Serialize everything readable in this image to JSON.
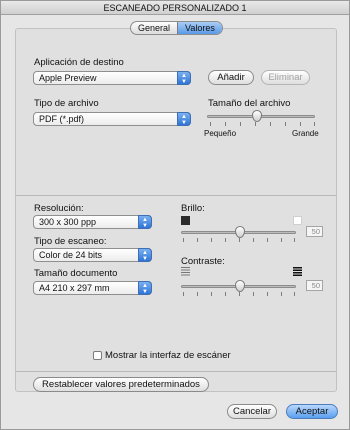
{
  "window": {
    "title": "ESCANEADO PERSONALIZADO 1"
  },
  "tabs": [
    {
      "label": "General",
      "active": false
    },
    {
      "label": "Valores",
      "active": true
    }
  ],
  "destination": {
    "label": "Aplicación de destino",
    "value": "Apple Preview",
    "add_label": "Añadir",
    "remove_label": "Eliminar"
  },
  "file_type": {
    "label": "Tipo de archivo",
    "value": "PDF (*.pdf)"
  },
  "file_size": {
    "label": "Tamaño del archivo",
    "min_label": "Pequeño",
    "max_label": "Grande",
    "level": 0.5
  },
  "resolution": {
    "label": "Resolución:",
    "value": "300 x 300 ppp"
  },
  "scan_type": {
    "label": "Tipo de escaneo:",
    "value": "Color de 24 bits"
  },
  "doc_size": {
    "label": "Tamaño documento",
    "value": "A4  210 x 297 mm"
  },
  "brightness": {
    "label": "Brillo:",
    "value": "50",
    "level": 0.5
  },
  "contrast": {
    "label": "Contraste:",
    "value": "50",
    "level": 0.5
  },
  "show_interface": {
    "label": "Mostrar la interfaz de escáner",
    "checked": false
  },
  "footer": {
    "reset_label": "Restablecer valores predeterminados",
    "cancel_label": "Cancelar",
    "ok_label": "Aceptar"
  },
  "colors": {
    "accent": "#5a9ae8"
  }
}
